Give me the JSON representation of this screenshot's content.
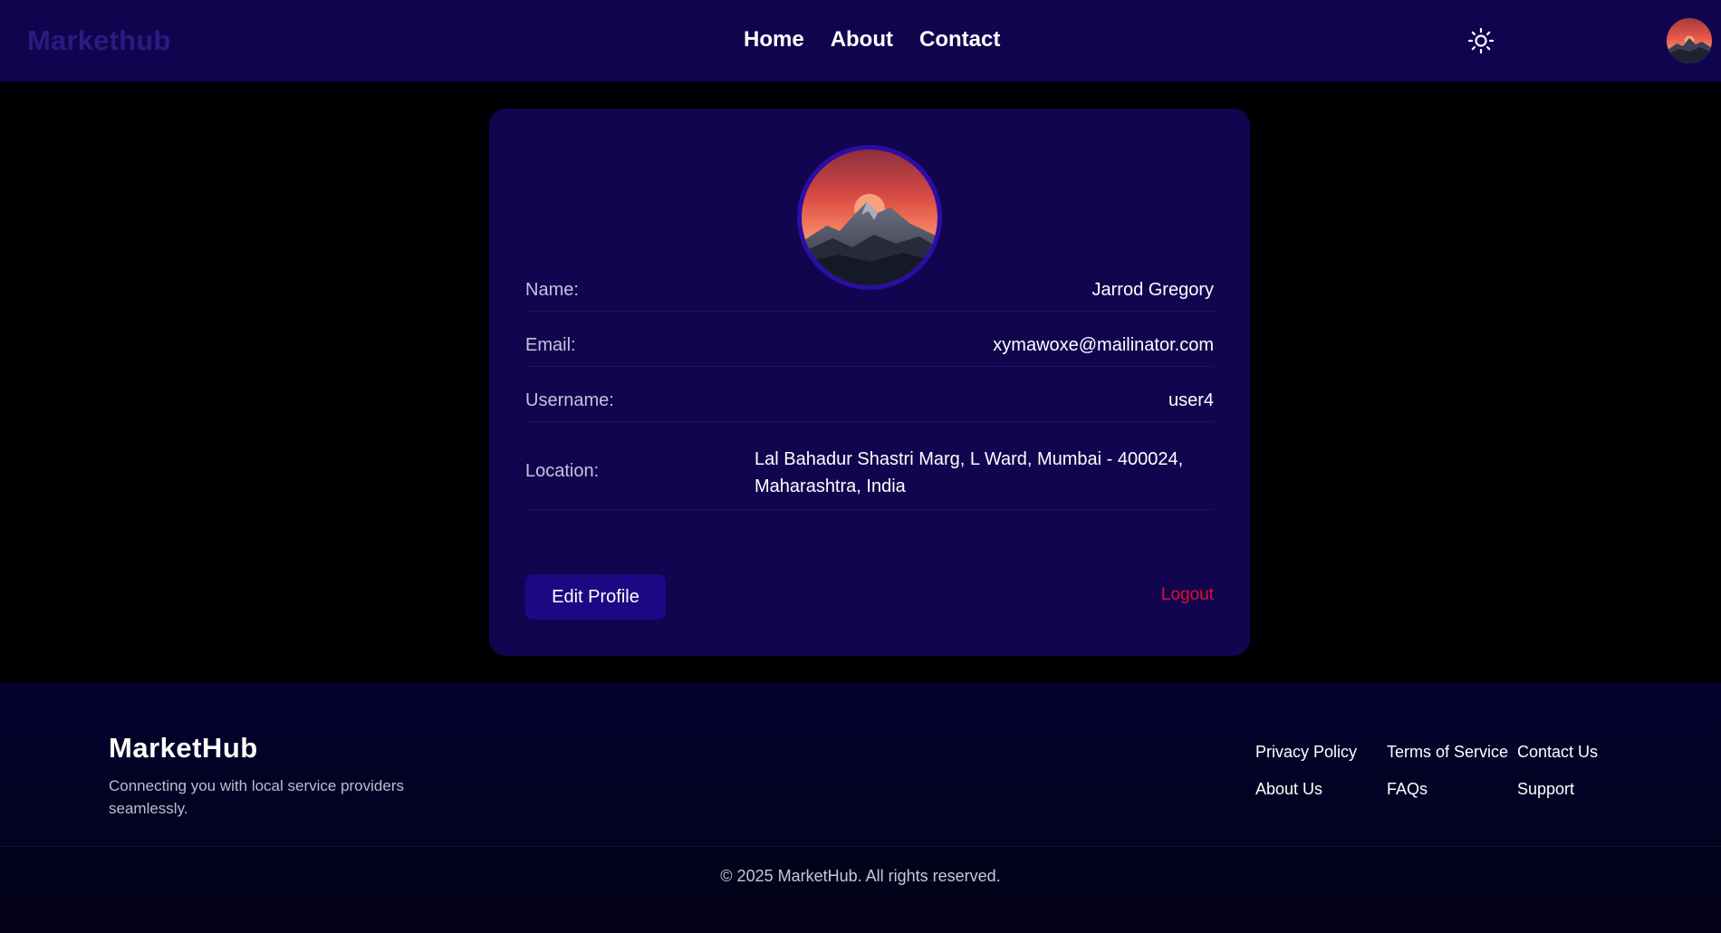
{
  "navbar": {
    "brand": "Markethub",
    "links": [
      "Home",
      "About",
      "Contact"
    ],
    "theme_icon": "sun-icon",
    "avatar_icon": "user-avatar"
  },
  "profile": {
    "avatar_icon": "mountain-sunset-avatar",
    "fields": [
      {
        "label": "Name:",
        "value": "Jarrod Gregory"
      },
      {
        "label": "Email:",
        "value": "xymawoxe@mailinator.com"
      },
      {
        "label": "Username:",
        "value": "user4"
      },
      {
        "label": "Location:",
        "value": "Lal Bahadur Shastri Marg, L Ward, Mumbai - 400024, Maharashtra, India"
      }
    ],
    "edit_label": "Edit Profile",
    "logout_label": "Logout"
  },
  "footer": {
    "brand": "MarketHub",
    "tagline": "Connecting you with local service providers seamlessly.",
    "links": [
      "Privacy Policy",
      "Terms of Service",
      "Contact Us",
      "About Us",
      "FAQs",
      "Support"
    ],
    "copyright": "© 2025 MarketHub. All rights reserved."
  },
  "colors": {
    "navbar_bg": "#11044f",
    "card_bg": "#12044f",
    "button_bg": "#1d0884",
    "logout": "#e0102e",
    "brand_muted": "#2c1a80"
  }
}
